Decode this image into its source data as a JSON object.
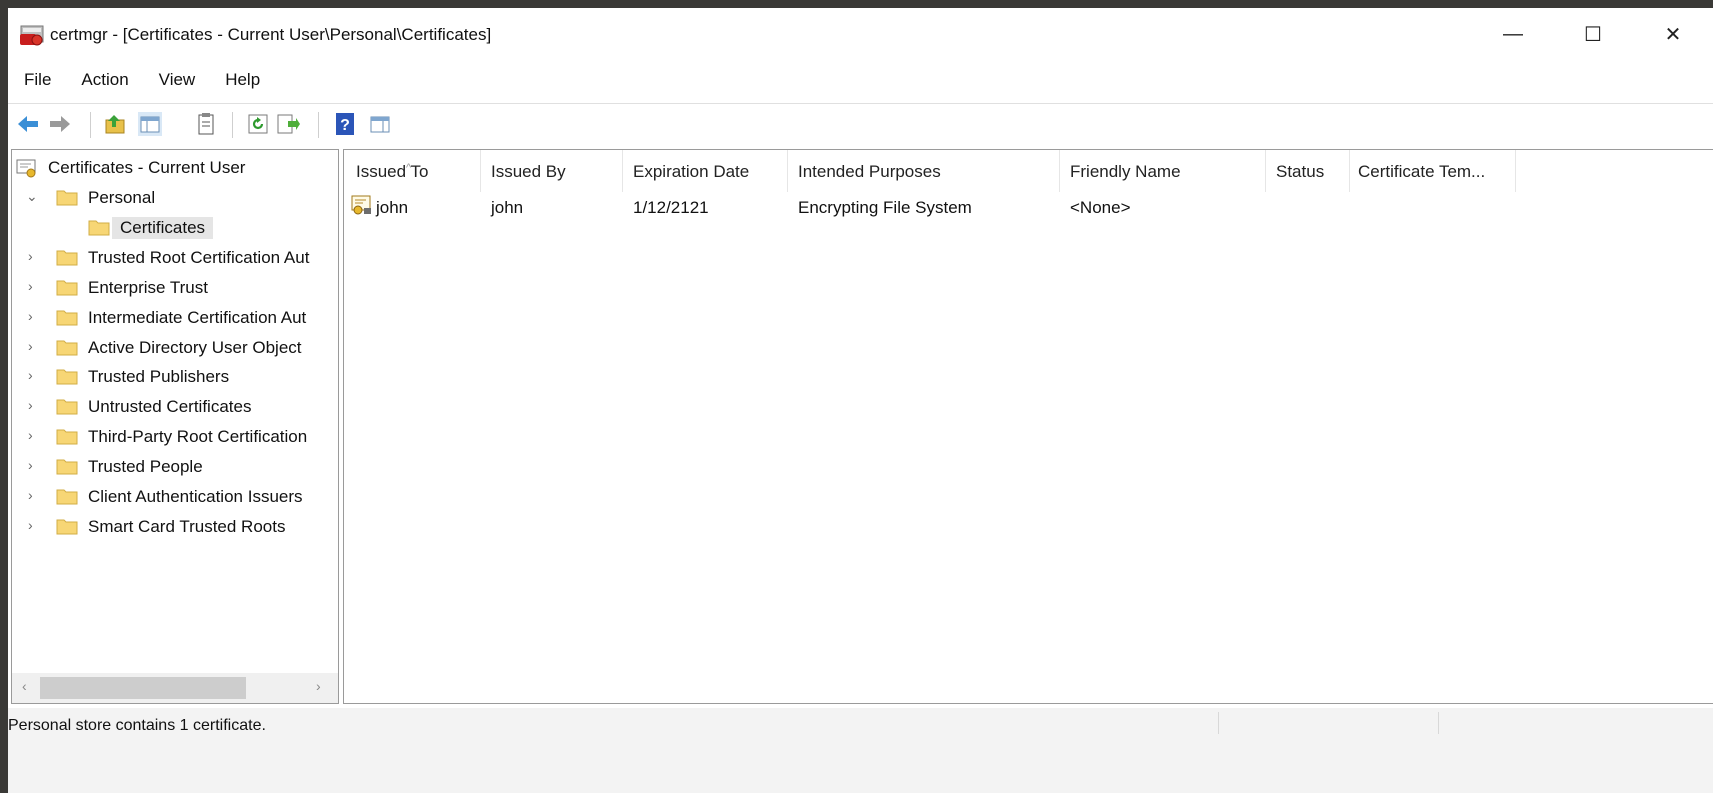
{
  "window": {
    "title": "certmgr - [Certificates - Current User\\Personal\\Certificates]",
    "minimize": "—",
    "maximize": "☐",
    "close": "✕"
  },
  "menu": [
    "File",
    "Action",
    "View",
    "Help"
  ],
  "toolbar": [
    "back-arrow-icon",
    "forward-arrow-icon",
    "up-folder-icon",
    "show-hide-console-tree-icon",
    "properties-icon",
    "refresh-icon",
    "export-list-icon",
    "help-icon",
    "show-hide-action-pane-icon"
  ],
  "tree": {
    "root": "Certificates - Current User",
    "items": [
      {
        "label": "Personal",
        "expanded": true
      },
      {
        "label": "Certificates",
        "selected": true
      },
      {
        "label": "Trusted Root Certification Aut"
      },
      {
        "label": "Enterprise Trust"
      },
      {
        "label": "Intermediate Certification Aut"
      },
      {
        "label": "Active Directory User Object"
      },
      {
        "label": "Trusted Publishers"
      },
      {
        "label": "Untrusted Certificates"
      },
      {
        "label": "Third-Party Root Certification"
      },
      {
        "label": "Trusted People"
      },
      {
        "label": "Client Authentication Issuers"
      },
      {
        "label": "Smart Card Trusted Roots"
      }
    ],
    "expand_glyph": "›",
    "collapse_glyph": "⌄",
    "scroll_left": "‹",
    "scroll_right": "›"
  },
  "list": {
    "columns": [
      "Issued To",
      "Issued By",
      "Expiration Date",
      "Intended Purposes",
      "Friendly Name",
      "Status",
      "Certificate Tem..."
    ],
    "sort_glyph": "^",
    "rows": [
      {
        "issued_to": "john",
        "issued_by": "john",
        "expiration": "1/12/2121",
        "purposes": "Encrypting File System",
        "friendly": "<None>",
        "status": "",
        "template": ""
      }
    ]
  },
  "status": {
    "text": "Personal store contains 1 certificate."
  },
  "colors": {
    "selection": "#e5e5e5",
    "folder": "#f7d675",
    "back_arrow": "#3b8fd6"
  }
}
